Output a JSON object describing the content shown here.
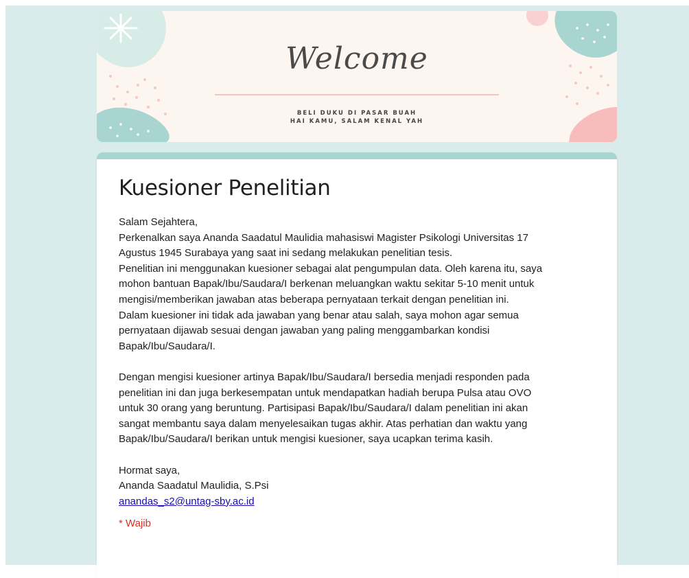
{
  "banner": {
    "title": "Welcome",
    "subtitle_line1": "BELI DUKU DI PASAR BUAH",
    "subtitle_line2": "HAI KAMU, SALAM KENAL YAH"
  },
  "form": {
    "title": "Kuesioner Penelitian",
    "description": "Salam Sejahtera,\nPerkenalkan saya Ananda Saadatul Maulidia mahasiswi Magister Psikologi Universitas 17\nAgustus 1945 Surabaya yang saat ini sedang melakukan penelitian tesis.\nPenelitian ini menggunakan kuesioner sebagai alat pengumpulan data. Oleh karena itu, saya\nmohon bantuan Bapak/Ibu/Saudara/I berkenan meluangkan waktu sekitar 5-10 menit untuk\nmengisi/memberikan jawaban atas beberapa pernyataan terkait dengan penelitian ini.\nDalam kuesioner ini tidak ada jawaban yang benar atau salah, saya mohon agar semua\npernyataan dijawab sesuai dengan jawaban yang paling menggambarkan kondisi\nBapak/Ibu/Saudara/I.\n\nDengan mengisi kuesioner artinya Bapak/Ibu/Saudara/I bersedia menjadi responden pada\npenelitian ini dan juga berkesempatan untuk mendapatkan hadiah berupa Pulsa atau OVO\nuntuk 30 orang yang beruntung. Partisipasi Bapak/Ibu/Saudara/I dalam penelitian ini akan\nsangat membantu saya dalam menyelesaikan tugas akhir. Atas perhatian dan waktu yang\nBapak/Ibu/Saudara/I berikan untuk mengisi kuesioner, saya ucapkan terima kasih.\n\nHormat saya,\nAnanda Saadatul Maulidia, S.Psi",
    "email": "anandas_s2@untag-sby.ac.id",
    "required_note": "* Wajib"
  },
  "colors": {
    "page_background": "#d9ebea",
    "accent": "#a8d5d0",
    "required": "#d93025",
    "link": "#1a0dab"
  }
}
